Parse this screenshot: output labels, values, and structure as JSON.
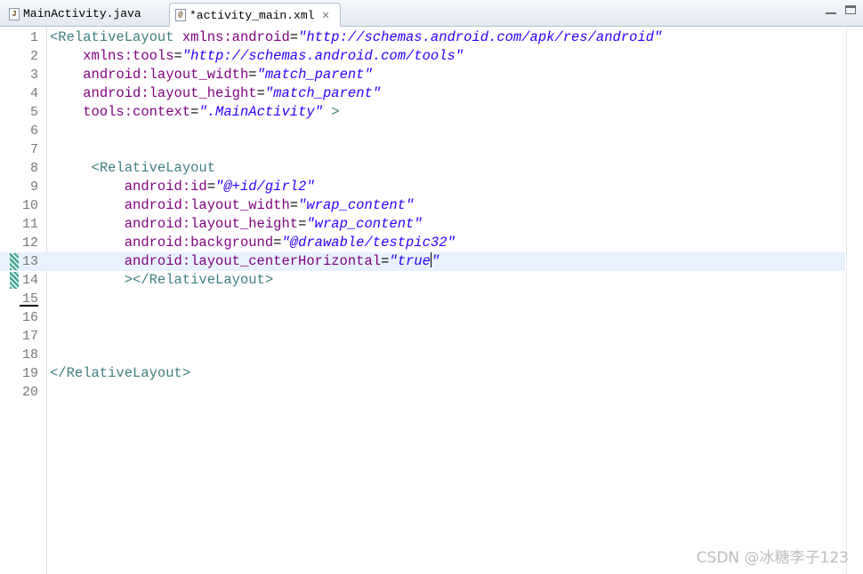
{
  "tabs": [
    {
      "icon": "java-file-icon",
      "icon_glyph": "J",
      "label": "MainActivity.java",
      "active": false
    },
    {
      "icon": "xml-file-icon",
      "icon_glyph": "@",
      "label": "*activity_main.xml",
      "active": true,
      "close": "✕"
    }
  ],
  "editor": {
    "current_line": 13,
    "line_numbers": [
      "1",
      "2",
      "3",
      "4",
      "5",
      "6",
      "7",
      "8",
      "9",
      "10",
      "11",
      "12",
      "13",
      "14",
      "15",
      "16",
      "17",
      "18",
      "19",
      "20"
    ],
    "lines": [
      [
        {
          "t": "<RelativeLayout",
          "c": "tag"
        },
        {
          "t": " ",
          "c": "eq"
        },
        {
          "t": "xmlns:android",
          "c": "attr"
        },
        {
          "t": "=",
          "c": "eq"
        },
        {
          "t": "\"http://schemas.android.com/apk/res/android\"",
          "c": "val"
        }
      ],
      [
        {
          "t": "    ",
          "c": "eq"
        },
        {
          "t": "xmlns:tools",
          "c": "attr"
        },
        {
          "t": "=",
          "c": "eq"
        },
        {
          "t": "\"http://schemas.android.com/tools\"",
          "c": "val"
        }
      ],
      [
        {
          "t": "    ",
          "c": "eq"
        },
        {
          "t": "android:layout_width",
          "c": "attr"
        },
        {
          "t": "=",
          "c": "eq"
        },
        {
          "t": "\"match_parent\"",
          "c": "val"
        }
      ],
      [
        {
          "t": "    ",
          "c": "eq"
        },
        {
          "t": "android:layout_height",
          "c": "attr"
        },
        {
          "t": "=",
          "c": "eq"
        },
        {
          "t": "\"match_parent\"",
          "c": "val"
        }
      ],
      [
        {
          "t": "    ",
          "c": "eq"
        },
        {
          "t": "tools:context",
          "c": "attr"
        },
        {
          "t": "=",
          "c": "eq"
        },
        {
          "t": "\".MainActivity\"",
          "c": "val"
        },
        {
          "t": " >",
          "c": "tag"
        }
      ],
      [],
      [],
      [
        {
          "t": "     ",
          "c": "eq"
        },
        {
          "t": "<RelativeLayout",
          "c": "tag"
        }
      ],
      [
        {
          "t": "         ",
          "c": "eq"
        },
        {
          "t": "android:id",
          "c": "attr"
        },
        {
          "t": "=",
          "c": "eq"
        },
        {
          "t": "\"@+id/girl2\"",
          "c": "val"
        }
      ],
      [
        {
          "t": "         ",
          "c": "eq"
        },
        {
          "t": "android:layout_width",
          "c": "attr"
        },
        {
          "t": "=",
          "c": "eq"
        },
        {
          "t": "\"wrap_content\"",
          "c": "val"
        }
      ],
      [
        {
          "t": "         ",
          "c": "eq"
        },
        {
          "t": "android:layout_height",
          "c": "attr"
        },
        {
          "t": "=",
          "c": "eq"
        },
        {
          "t": "\"wrap_content\"",
          "c": "val"
        }
      ],
      [
        {
          "t": "         ",
          "c": "eq"
        },
        {
          "t": "android:background",
          "c": "attr"
        },
        {
          "t": "=",
          "c": "eq"
        },
        {
          "t": "\"@drawable/testpic32\"",
          "c": "val"
        }
      ],
      [
        {
          "t": "         ",
          "c": "eq"
        },
        {
          "t": "android:layout_centerHorizontal",
          "c": "attr"
        },
        {
          "t": "=",
          "c": "eq"
        },
        {
          "t": "\"true",
          "c": "val",
          "caret": true
        },
        {
          "t": "\"",
          "c": "val"
        }
      ],
      [
        {
          "t": "         ",
          "c": "eq"
        },
        {
          "t": "></RelativeLayout>",
          "c": "tag"
        }
      ],
      [],
      [],
      [],
      [],
      [
        {
          "t": "</RelativeLayout>",
          "c": "tag"
        }
      ],
      []
    ],
    "change_markers": [
      13,
      14
    ]
  },
  "watermark": "CSDN @冰糖李子123",
  "colors": {
    "tag": "#3f7f7f",
    "attribute": "#7f007f",
    "value": "#2a00ff",
    "current_line": "#e8f2fe",
    "line_number": "#787878"
  }
}
